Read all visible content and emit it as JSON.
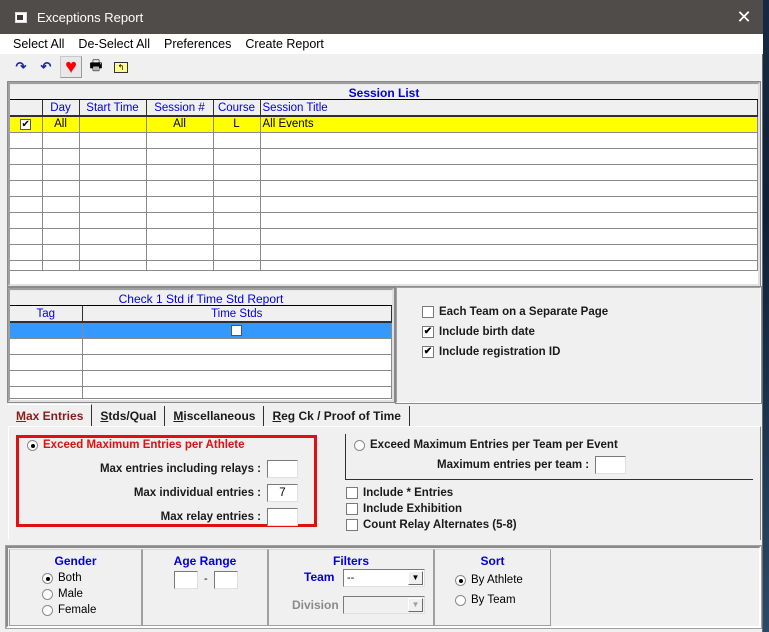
{
  "window": {
    "title": "Exceptions Report",
    "close_glyph": "✕"
  },
  "menu": [
    "Select All",
    "De-Select All",
    "Preferences",
    "Create Report"
  ],
  "toolbar": {
    "redo_glyph": "↷",
    "undo_glyph": "↶",
    "heart_glyph": "♥",
    "print_glyph": "🖶",
    "folder_glyph": "↰"
  },
  "session_list": {
    "title": "Session List",
    "columns": [
      "",
      "Day",
      "Start Time",
      "Session #",
      "Course",
      "Session Title"
    ],
    "rows": [
      {
        "checked": true,
        "check_glyph": "✔",
        "day": "All",
        "start_time": "",
        "session": "All",
        "course": "L",
        "title": "All Events"
      }
    ],
    "highlight_color": "#ffff00"
  },
  "time_stds": {
    "title": "Check 1 Std if Time Std Report",
    "columns": [
      "Tag",
      "Time Stds"
    ],
    "selected_row_color": "#3399ff"
  },
  "options": [
    {
      "label": "Each Team on a Separate Page",
      "checked": false,
      "glyph": ""
    },
    {
      "label": "Include birth date",
      "checked": true,
      "glyph": "✔"
    },
    {
      "label": "Include registration ID",
      "checked": true,
      "glyph": "✔"
    }
  ],
  "tabs": [
    {
      "accel": "M",
      "rest": "ax Entries",
      "active": true
    },
    {
      "accel": "S",
      "rest": "tds/Qual",
      "active": false
    },
    {
      "accel": "M",
      "rest": "iscellaneous",
      "active": false
    },
    {
      "accel": "R",
      "rest": "eg Ck / Proof of Time",
      "active": false
    }
  ],
  "max_entries": {
    "athlete_radio": {
      "label": "Exceed Maximum Entries per Athlete",
      "selected": true,
      "color": "#e01010"
    },
    "fields": [
      {
        "label": "Max entries including relays :",
        "value": ""
      },
      {
        "label": "Max individual entries :",
        "value": "7"
      },
      {
        "label": "Max relay entries :",
        "value": ""
      }
    ],
    "team_radio": {
      "label": "Exceed Maximum Entries per Team per Event",
      "selected": false
    },
    "team_field": {
      "label": "Maximum entries per team :",
      "value": ""
    },
    "checks": [
      {
        "label": "Include * Entries",
        "checked": false
      },
      {
        "label": "Include Exhibition",
        "checked": false
      },
      {
        "label": "Count Relay Alternates (5-8)",
        "checked": false
      }
    ]
  },
  "gender": {
    "title": "Gender",
    "options": [
      {
        "label": "Both",
        "selected": true
      },
      {
        "label": "Male",
        "selected": false
      },
      {
        "label": "Female",
        "selected": false
      }
    ]
  },
  "age_range": {
    "title": "Age Range",
    "from": "",
    "to": "",
    "separator": "-"
  },
  "filters": {
    "title": "Filters",
    "team_label": "Team",
    "team_value": "--",
    "division_label": "Division",
    "division_value": "",
    "arrow_glyph": "▼"
  },
  "sort": {
    "title": "Sort",
    "options": [
      {
        "label": "By Athlete",
        "selected": true
      },
      {
        "label": "By Team",
        "selected": false
      }
    ]
  }
}
